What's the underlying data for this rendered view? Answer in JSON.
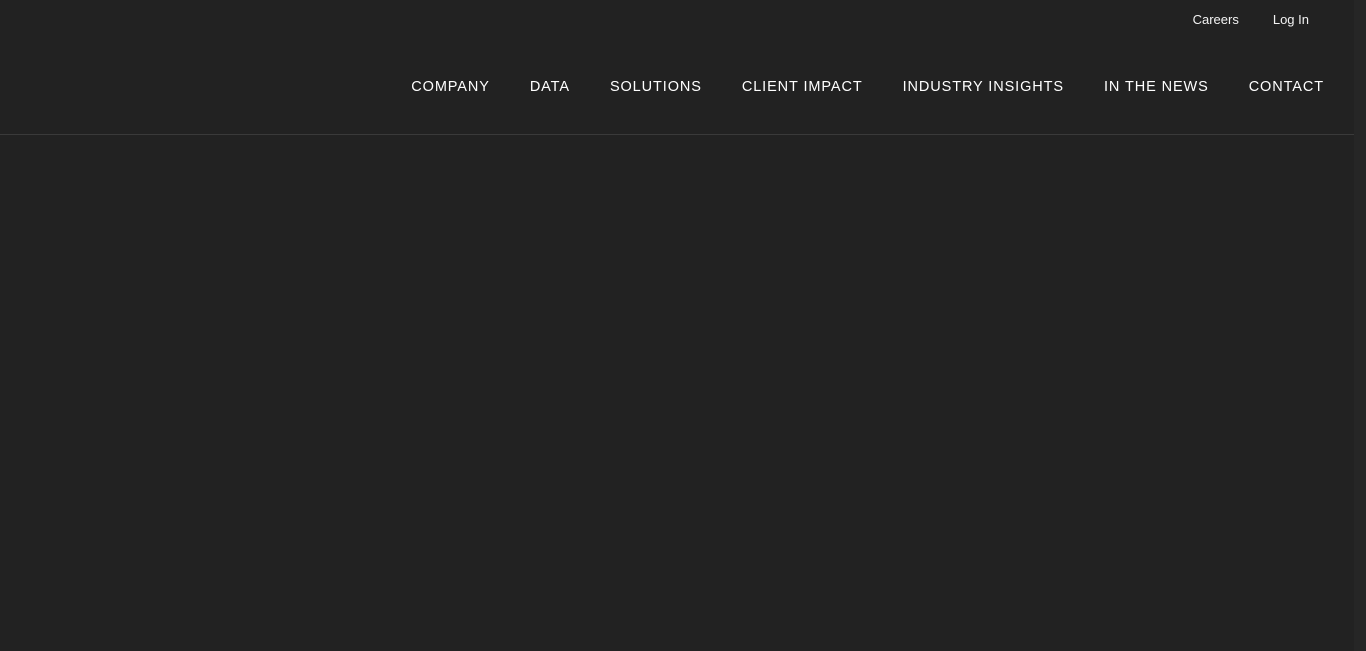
{
  "utility_nav": {
    "items": [
      {
        "label": "Careers"
      },
      {
        "label": "Log In"
      }
    ]
  },
  "main_nav": {
    "items": [
      {
        "label": "COMPANY"
      },
      {
        "label": "DATA"
      },
      {
        "label": "SOLUTIONS"
      },
      {
        "label": "CLIENT IMPACT"
      },
      {
        "label": "INDUSTRY INSIGHTS"
      },
      {
        "label": "IN THE NEWS"
      },
      {
        "label": "CONTACT"
      }
    ]
  },
  "colors": {
    "background": "#222222",
    "text": "#ffffff",
    "divider": "#3a3a3a"
  }
}
